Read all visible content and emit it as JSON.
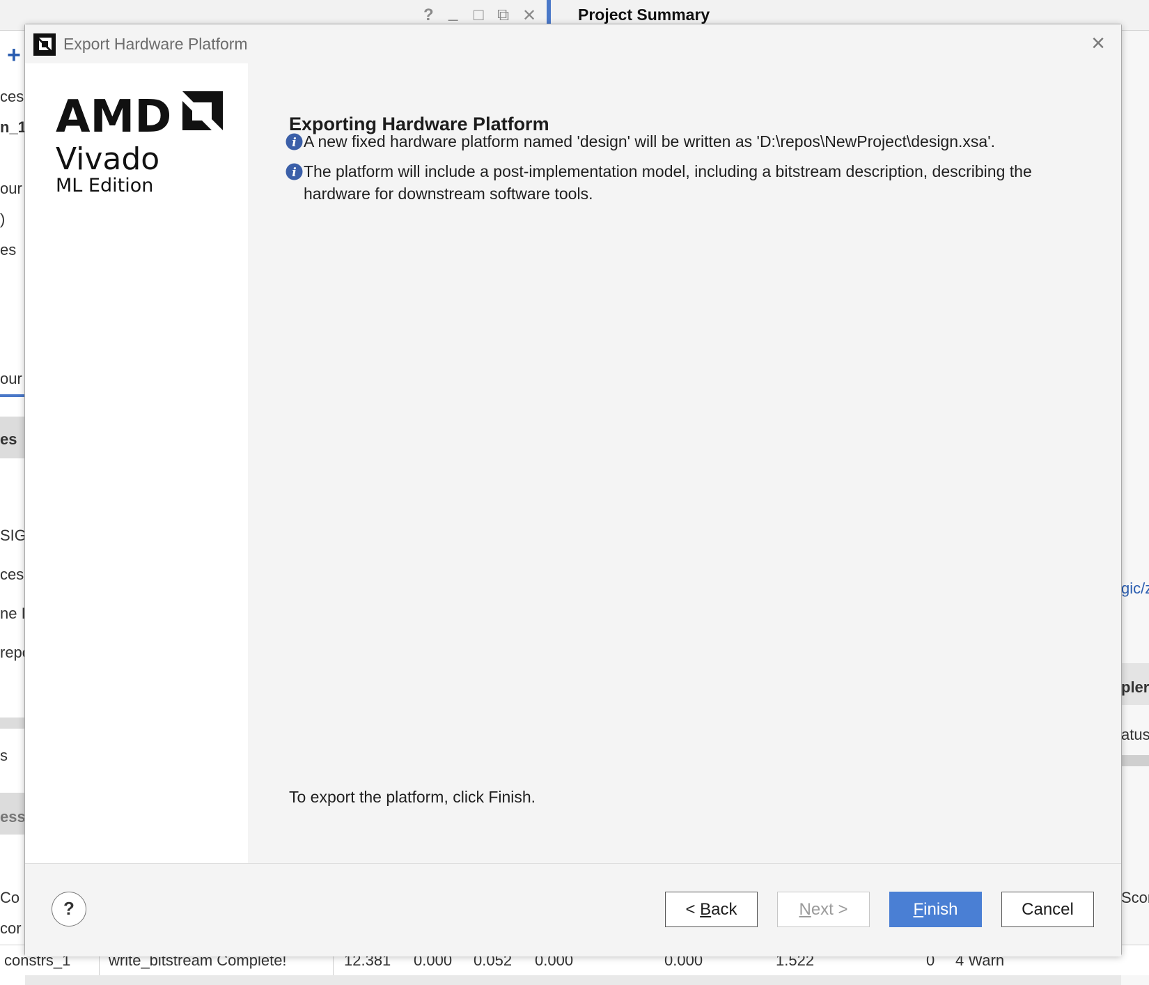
{
  "background": {
    "project_summary": "Project Summary",
    "left_fragments": [
      "ces",
      "n_1",
      "our",
      ")",
      "es",
      "our",
      "es",
      "SIGN",
      "ces",
      "ne I",
      "repo",
      "s",
      "essa",
      "Co",
      "cor"
    ],
    "right_fragments": [
      "gic/z",
      "pler",
      "atus",
      "Scor"
    ],
    "bottom_row": {
      "col1": "constrs_1",
      "col2": "write_bitstream Complete!",
      "col3": "12.381",
      "col4": "0.000",
      "col5": "0.052",
      "col6": "0.000",
      "col7": "0.000",
      "col8": "1.522",
      "col9": "0",
      "col10": "4 Warn"
    }
  },
  "dialog": {
    "title": "Export Hardware Platform",
    "logo": {
      "brand": "AMD",
      "product": "Vivado",
      "edition": "ML Edition"
    },
    "heading": "Exporting Hardware Platform",
    "info_messages": [
      "A new fixed hardware platform named 'design' will be written as 'D:\\repos\\NewProject\\design.xsa'.",
      "The platform will include a post-implementation model, including a bitstream description, describing the hardware for downstream software tools."
    ],
    "footer_note": "To export the platform, click Finish.",
    "buttons": {
      "back": {
        "prefix": "< ",
        "mnemonic": "B",
        "rest": "ack"
      },
      "next": {
        "mnemonic": "N",
        "rest": "ext >"
      },
      "finish": {
        "mnemonic": "F",
        "rest": "inish"
      },
      "cancel": "Cancel",
      "help": "?"
    }
  },
  "colors": {
    "primary_button": "#4a7fd4",
    "info_icon": "#3b5fa8",
    "accent_bar": "#4a78c8"
  }
}
